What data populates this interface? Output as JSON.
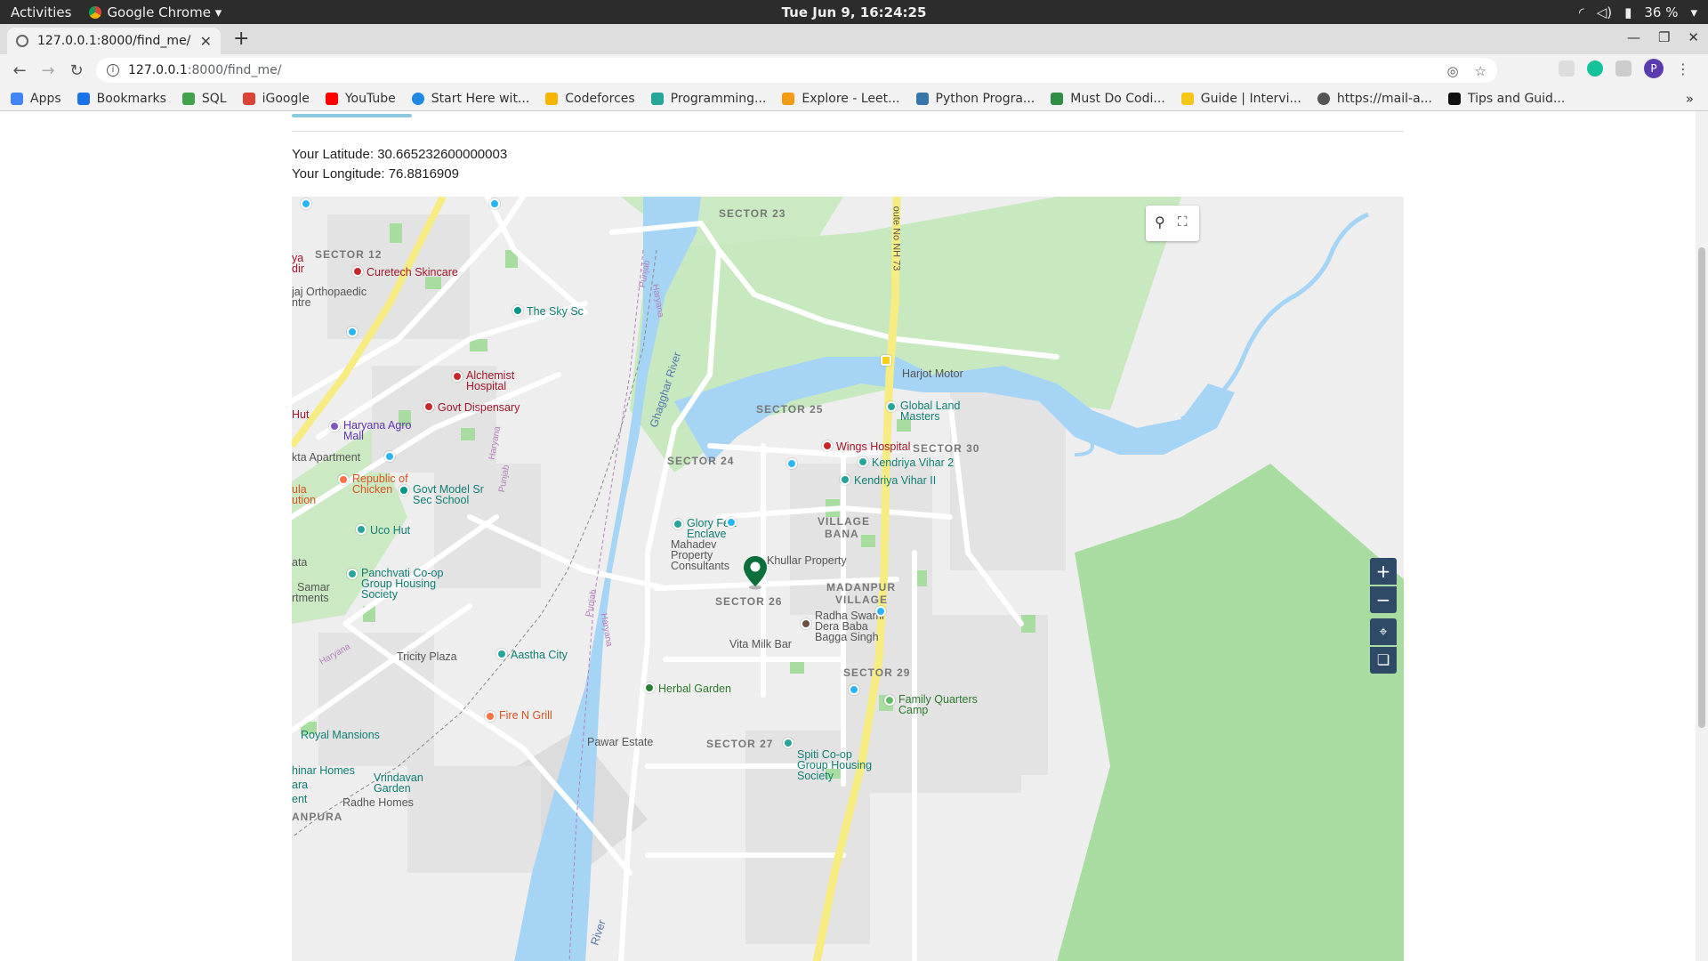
{
  "system_bar": {
    "activities": "Activities",
    "app": "Google Chrome",
    "clock": "Tue Jun  9, 16:24:25",
    "battery": "36 %"
  },
  "browser": {
    "tab_title": "127.0.0.1:8000/find_me/",
    "url_host": "127.0.0.1",
    "url_path": ":8000/find_me/",
    "bookmarks": [
      {
        "label": "Apps",
        "color": "#4285f4"
      },
      {
        "label": "Bookmarks",
        "color": "#1a73e8"
      },
      {
        "label": "SQL",
        "color": "#3fa34d"
      },
      {
        "label": "iGoogle",
        "color": "#db4437"
      },
      {
        "label": "YouTube",
        "color": "#ff0000"
      },
      {
        "label": "Start Here wit...",
        "color": "#1e88e5"
      },
      {
        "label": "Codeforces",
        "color": "#f4b400"
      },
      {
        "label": "Programming...",
        "color": "#26a69a"
      },
      {
        "label": "Explore - Leet...",
        "color": "#f39c12"
      },
      {
        "label": "Python Progra...",
        "color": "#3776ab"
      },
      {
        "label": "Must Do Codi...",
        "color": "#2f8d46"
      },
      {
        "label": "Guide | Intervi...",
        "color": "#f5c518"
      },
      {
        "label": "https://mail-a...",
        "color": "#555555"
      },
      {
        "label": "Tips and Guid...",
        "color": "#111111"
      }
    ],
    "profile_initial": "P"
  },
  "page": {
    "latitude_label": "Your Latitude: 30.665232600000003",
    "longitude_label": "Your Longitude: 76.8816909"
  },
  "map": {
    "colors": {
      "water": "#a6d4f5",
      "park": "#cbeac3",
      "forest": "#a7dca0",
      "road": "#ffffff",
      "highway": "#f7ec82",
      "marker": "#0b6e3b"
    },
    "sectors": [
      "SECTOR 23",
      "SECTOR 12",
      "SECTOR 25",
      "SECTOR 24",
      "SECTOR 30",
      "VILLAGE",
      "BANA",
      "MADANPUR",
      "VILLAGE",
      "SECTOR 26",
      "SECTOR 29",
      "SECTOR 27",
      "ANPURA"
    ],
    "places": [
      "Curetech Skincare",
      "jaj Orthopaedic",
      "ntre",
      "The Sky Sc",
      "Alchemist",
      "Hospital",
      "Govt Dispensary",
      "Haryana Agro",
      "Mall",
      "kta Apartment",
      "Republic of",
      "Chicken",
      "Govt Model Sr",
      "Sec School",
      "Uco Hut",
      "Panchvati Co-op",
      "Group Housing",
      "Society",
      "Samar",
      "rtments",
      "Tricity Plaza",
      "Aastha City",
      "Fire N Grill",
      "Royal Mansions",
      "hinar Homes",
      "Vrindavan",
      "Garden",
      "Radhe Homes",
      "Ghagghar River",
      "Harjot Motor",
      "Global Land",
      "Masters",
      "Wings Hospital",
      "Kendriya Vihar 2",
      "Kendriya Vihar II",
      "Glory Fert",
      "Enclave",
      "Mahadev",
      "Property",
      "Consultants",
      "Khullar Property",
      "Radha Swami",
      "Dera Baba",
      "Bagga Singh",
      "Vita Milk Bar",
      "Herbal Garden",
      "Family Quarters",
      "Camp",
      "Pawar Estate",
      "Spiti Co-op",
      "Group Housing",
      "Society",
      "oute No NH 73",
      "River",
      "ya",
      "dir",
      "Hut",
      "ula",
      "ution",
      "ata",
      "ent",
      "ara"
    ],
    "small_labels": [
      "Punjab",
      "Haryana",
      "Haryana",
      "Punjab",
      "Punjab",
      "Haryana",
      "Haryana"
    ]
  }
}
